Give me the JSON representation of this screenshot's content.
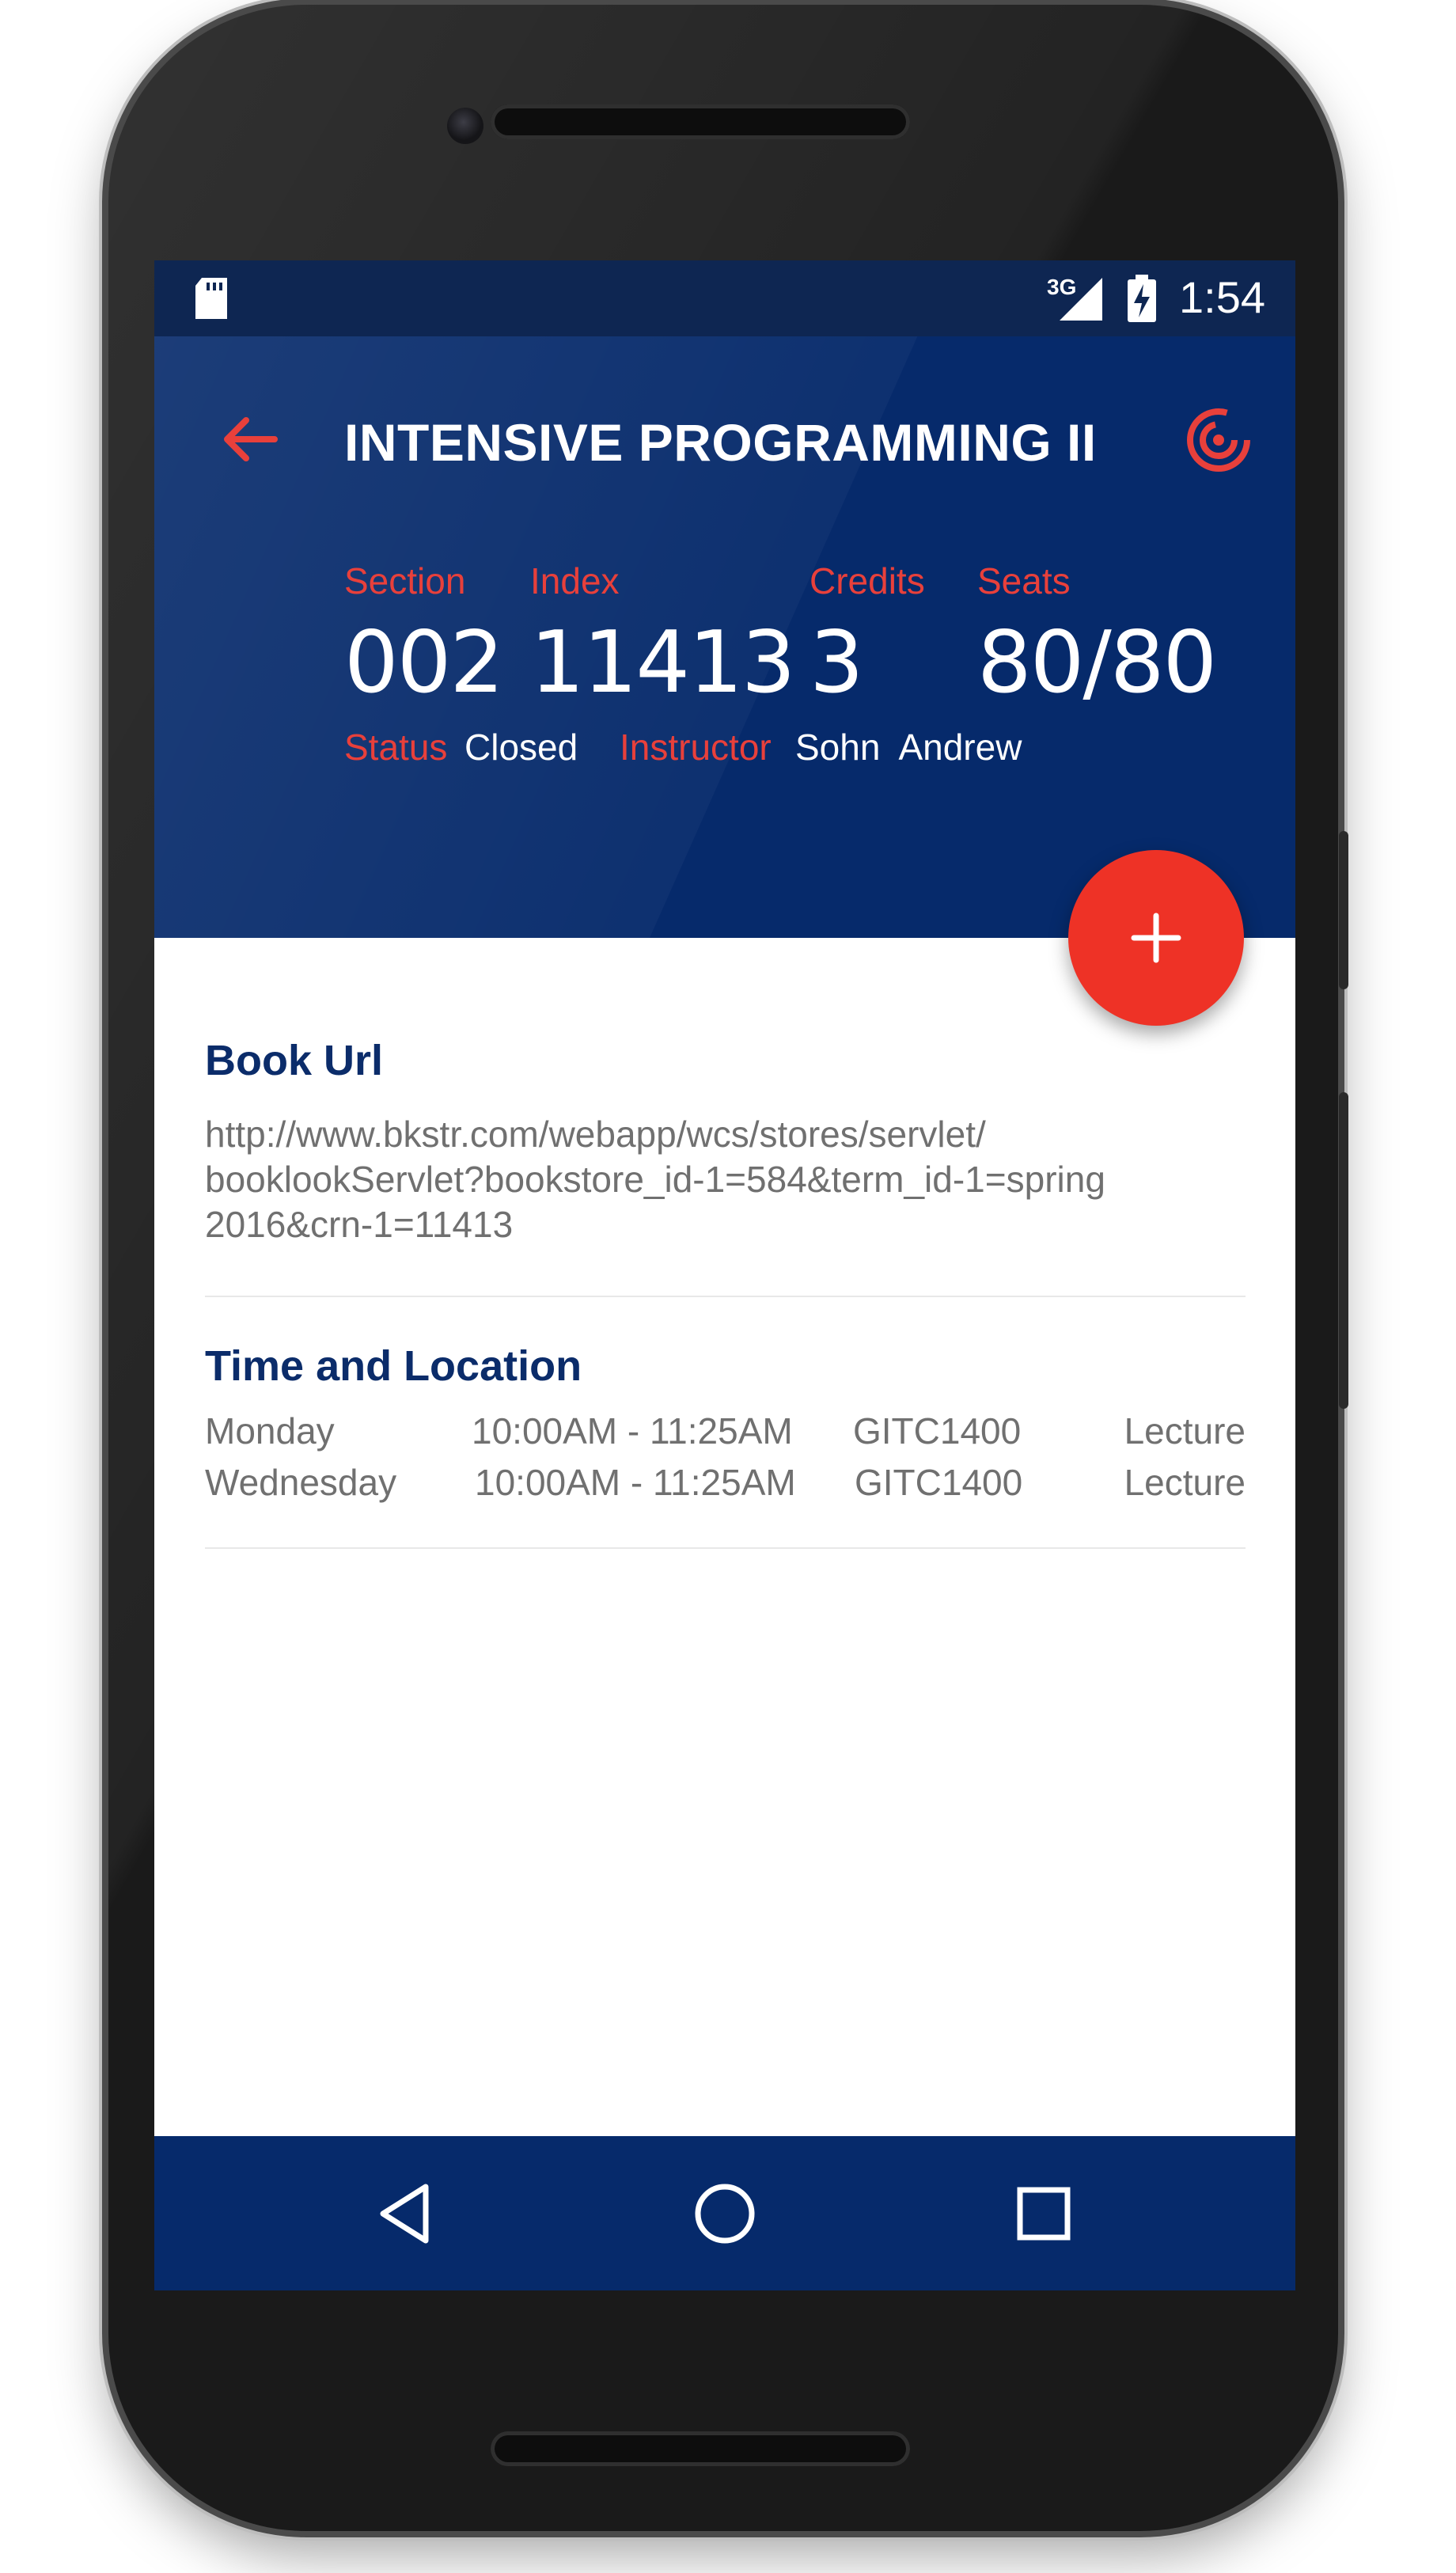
{
  "status_bar": {
    "time": "1:54",
    "network": "3G",
    "icons": [
      "sd-card-icon",
      "signal-icon",
      "battery-charging-icon"
    ]
  },
  "app_bar": {
    "title": "INTENSIVE PROGRAMMING II",
    "back_icon": "arrow-left-icon",
    "action_icon": "radar-track-icon"
  },
  "course": {
    "section_label": "Section",
    "section_value": "002",
    "index_label": "Index",
    "index_value": "11413",
    "credits_label": "Credits",
    "credits_value": "3",
    "seats_label": "Seats",
    "seats_value": "80/80",
    "status_label": "Status",
    "status_value": "Closed",
    "instructor_label": "Instructor",
    "instructor_value": "Sohn  Andrew"
  },
  "fab": {
    "icon": "plus-icon"
  },
  "book": {
    "title": "Book Url",
    "lines": [
      "http://www.bkstr.com/webapp/wcs/stores/servlet/",
      "booklookServlet?bookstore_id-1=584&term_id-1=spring",
      "2016&crn-1=11413"
    ]
  },
  "time_location": {
    "title": "Time and Location",
    "rows": [
      {
        "day": "Monday",
        "time": "10:00AM - 11:25AM",
        "room": "GITC1400",
        "type": "Lecture"
      },
      {
        "day": "Wednesday",
        "time": "10:00AM - 11:25AM",
        "room": "GITC1400",
        "type": "Lecture"
      }
    ]
  },
  "nav_bar": {
    "icons": [
      "back-triangle-icon",
      "home-circle-icon",
      "recents-square-icon"
    ]
  },
  "colors": {
    "primary": "#062a6b",
    "accent": "#ee3226",
    "title_blue": "#0b2c6a",
    "text_grey": "#707070"
  }
}
